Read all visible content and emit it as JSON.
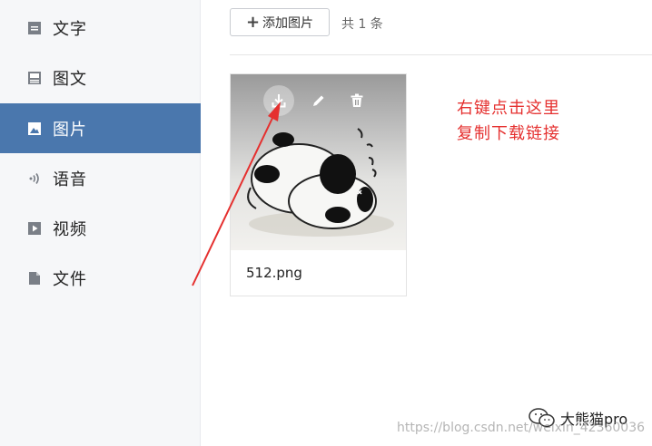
{
  "sidebar": {
    "items": [
      {
        "label": "文字",
        "icon": "text-icon",
        "active": false
      },
      {
        "label": "图文",
        "icon": "image-text-icon",
        "active": false
      },
      {
        "label": "图片",
        "icon": "image-icon",
        "active": true
      },
      {
        "label": "语音",
        "icon": "voice-icon",
        "active": false
      },
      {
        "label": "视频",
        "icon": "video-icon",
        "active": false
      },
      {
        "label": "文件",
        "icon": "file-icon",
        "active": false
      }
    ]
  },
  "toolbar": {
    "add_label": "添加图片",
    "count_text": "共 1 条"
  },
  "gallery": {
    "items": [
      {
        "filename": "512.png",
        "tools": [
          "download-icon",
          "edit-icon",
          "delete-icon"
        ]
      }
    ]
  },
  "annotation": {
    "line1": "右键点击这里",
    "line2": "复制下载链接",
    "color": "#e5302f"
  },
  "watermark": {
    "name": "大熊猫pro",
    "url": "https://blog.csdn.net/weixin_42360036"
  },
  "colors": {
    "active": "#4a77ad",
    "annotation": "#e5302f"
  }
}
